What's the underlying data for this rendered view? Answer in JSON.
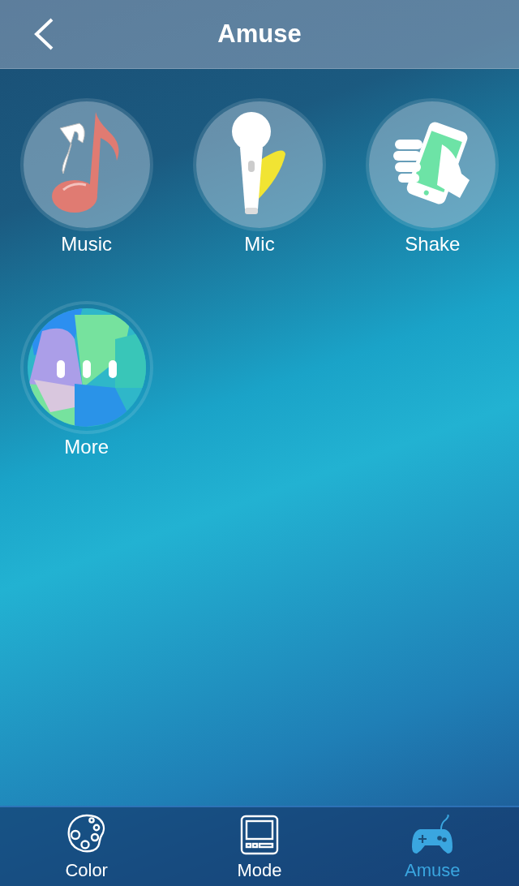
{
  "header": {
    "title": "Amuse"
  },
  "tiles": [
    {
      "kind": "music",
      "label": "Music"
    },
    {
      "kind": "mic",
      "label": "Mic"
    },
    {
      "kind": "shake",
      "label": "Shake"
    },
    {
      "kind": "more",
      "label": "More"
    }
  ],
  "tabs": [
    {
      "kind": "color",
      "label": "Color",
      "selected": false
    },
    {
      "kind": "mode",
      "label": "Mode",
      "selected": false
    },
    {
      "kind": "amuse",
      "label": "Amuse",
      "selected": true
    }
  ]
}
